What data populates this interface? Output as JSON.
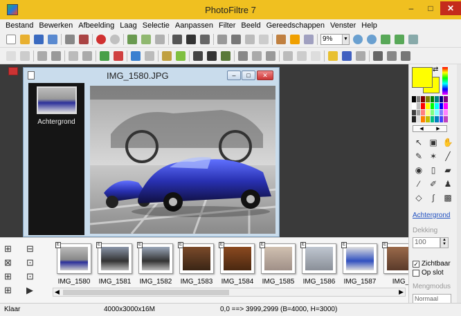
{
  "app": {
    "title": "PhotoFiltre 7"
  },
  "menu": [
    "Bestand",
    "Bewerken",
    "Afbeelding",
    "Laag",
    "Selectie",
    "Aanpassen",
    "Filter",
    "Beeld",
    "Gereedschappen",
    "Venster",
    "Help"
  ],
  "toolbar": {
    "zoom_value": "9%"
  },
  "image_window": {
    "title": "IMG_1580.JPG",
    "layer_label": "Achtergrond"
  },
  "right_panel": {
    "layer_name": "Achtergrond",
    "opacity_label": "Dekking",
    "opacity_value": "100",
    "visible_label": "Zichtbaar",
    "visible_checked": "✓",
    "lock_label": "Op slot",
    "blend_label": "Mengmodus",
    "blend_value": "Normaal",
    "palette": [
      "#000000",
      "#808080",
      "#800000",
      "#808000",
      "#008000",
      "#008080",
      "#000080",
      "#800080",
      "#ffffff",
      "#c0c0c0",
      "#ff0000",
      "#ffff00",
      "#00ff00",
      "#00ffff",
      "#0000ff",
      "#ff00ff",
      "#404040",
      "#a0a0a0",
      "#ff8080",
      "#ffff80",
      "#80ff80",
      "#80ffff",
      "#8080ff",
      "#ff80ff",
      "#202020",
      "#e0e0e0",
      "#ff8000",
      "#c0c000",
      "#00c080",
      "#0080c0",
      "#4040ff",
      "#c040c0"
    ]
  },
  "thumbnails": [
    {
      "label": "IMG_1580",
      "tone": "linear-gradient(#bbb,#888 55%,#2b2f9a 65%,#ccc)"
    },
    {
      "label": "IMG_1581",
      "tone": "linear-gradient(#8a95a8,#333 60%,#bbb)"
    },
    {
      "label": "IMG_1582",
      "tone": "linear-gradient(#9aa6b8,#333 60%,#bbb)"
    },
    {
      "label": "IMG_1583",
      "tone": "linear-gradient(#7a4a2a,#3a2515)"
    },
    {
      "label": "IMG_1584",
      "tone": "linear-gradient(#8b4a20,#4a2810)"
    },
    {
      "label": "IMG_1585",
      "tone": "linear-gradient(#d0c0b0,#a09088)"
    },
    {
      "label": "IMG_1586",
      "tone": "linear-gradient(#bfc6d0,#8a8f98)"
    },
    {
      "label": "IMG_1587",
      "tone": "linear-gradient(#e0e0e0,#3050c0 60%,#ddd)"
    },
    {
      "label": "IMG_",
      "tone": "linear-gradient(#9a6a4a,#5a3a2a)"
    }
  ],
  "status": {
    "text": "Klaar",
    "size": "4000x3000x16M",
    "coords": "0,0 ==> 3999,2999 (B=4000, H=3000)"
  }
}
